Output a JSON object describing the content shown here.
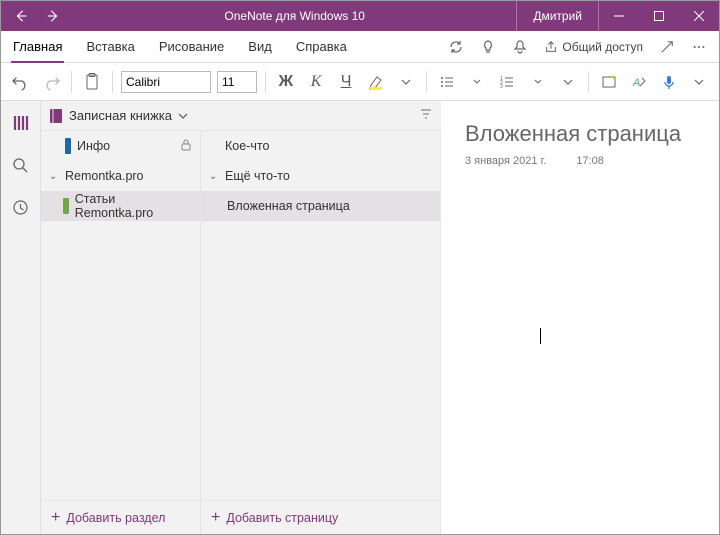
{
  "titlebar": {
    "app_title": "OneNote для Windows 10",
    "user": "Дмитрий"
  },
  "tabs": {
    "items": [
      "Главная",
      "Вставка",
      "Рисование",
      "Вид",
      "Справка"
    ],
    "active_index": 0,
    "share_label": "Общий доступ"
  },
  "ribbon": {
    "font_name": "Calibri",
    "font_size": "11"
  },
  "notebook": {
    "label": "Записная книжка"
  },
  "sections": {
    "info": "Инфо",
    "group": "Remontka.pro",
    "child": "Статьи Remontka.pro",
    "add_label": "Добавить раздел",
    "info_color": "#1b6ba3",
    "child_color": "#6fa84f"
  },
  "pages": {
    "top": "Кое-что",
    "group": "Ещё что-то",
    "child": "Вложенная страница",
    "add_label": "Добавить страницу"
  },
  "page": {
    "title": "Вложенная страница",
    "date": "3 января 2021 г.",
    "time": "17:08"
  }
}
